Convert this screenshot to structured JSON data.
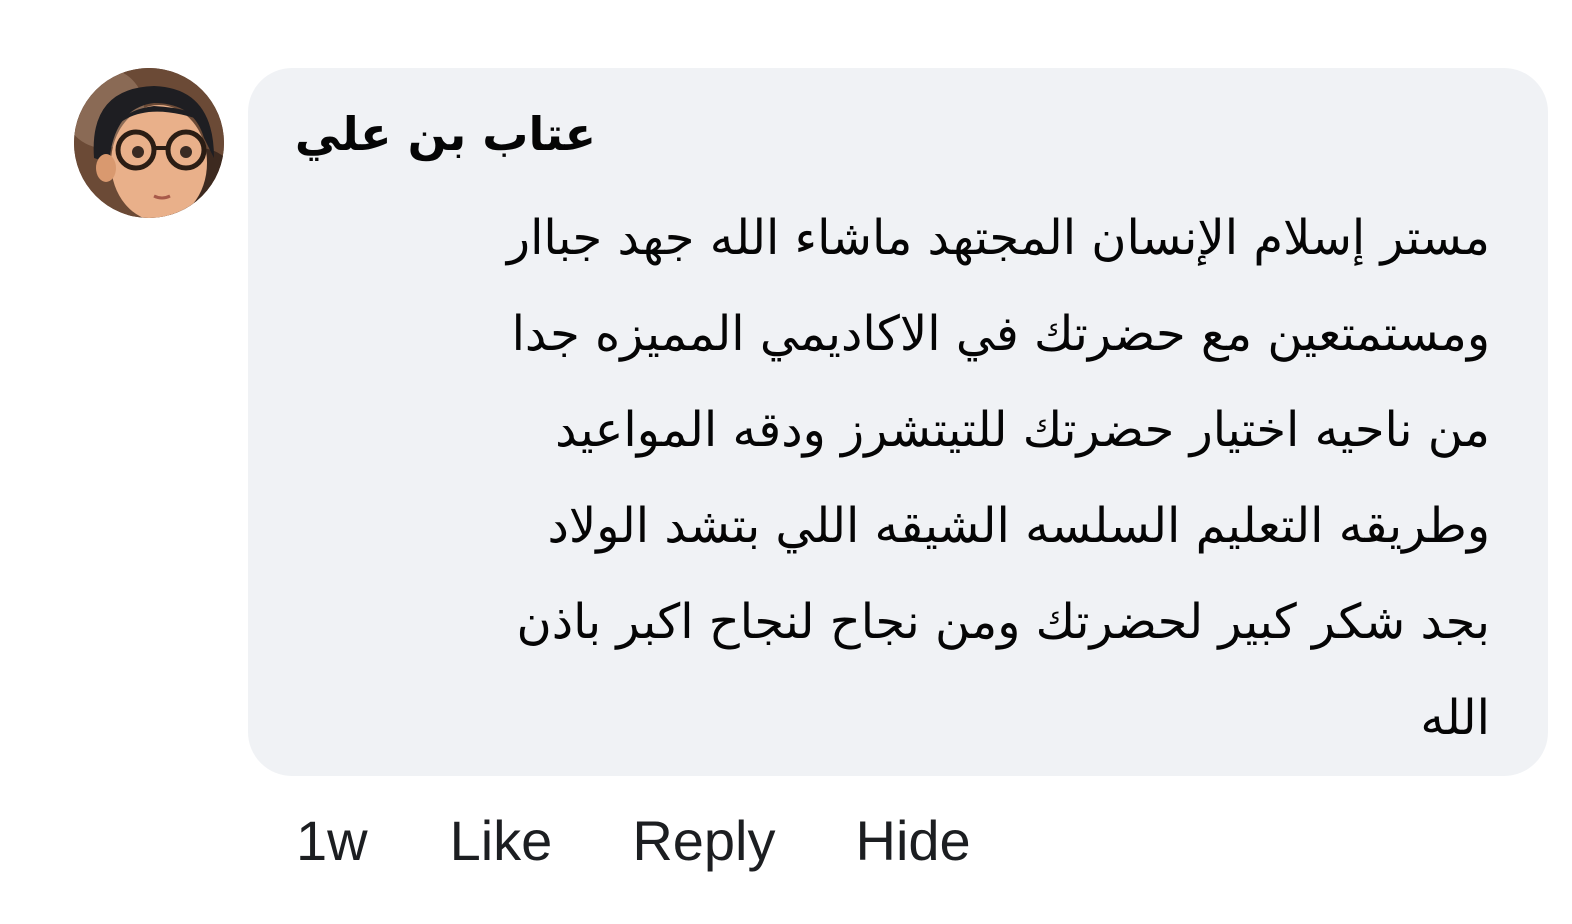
{
  "comment": {
    "author": "عتاب بن علي",
    "avatar_icon": "avatar-girl-with-glasses",
    "body_lines": [
      "مستر إسلام الإنسان المجتهد ماشاء الله جهد جباار",
      "ومستمتعين مع حضرتك في الاكاديمي  المميزه جدا",
      "من ناحيه اختيار حضرتك للتيتشرز ودقه المواعيد",
      "وطريقه التعليم السلسه  الشيقه اللي بتشد الولاد",
      "بجد شكر كبير لحضرتك  ومن نجاح لنجاح اكبر باذن",
      "الله"
    ],
    "timestamp": "1w",
    "actions": {
      "like": "Like",
      "reply": "Reply",
      "hide": "Hide"
    },
    "bubble_color": "#f0f2f5",
    "text_color": "#050505"
  }
}
